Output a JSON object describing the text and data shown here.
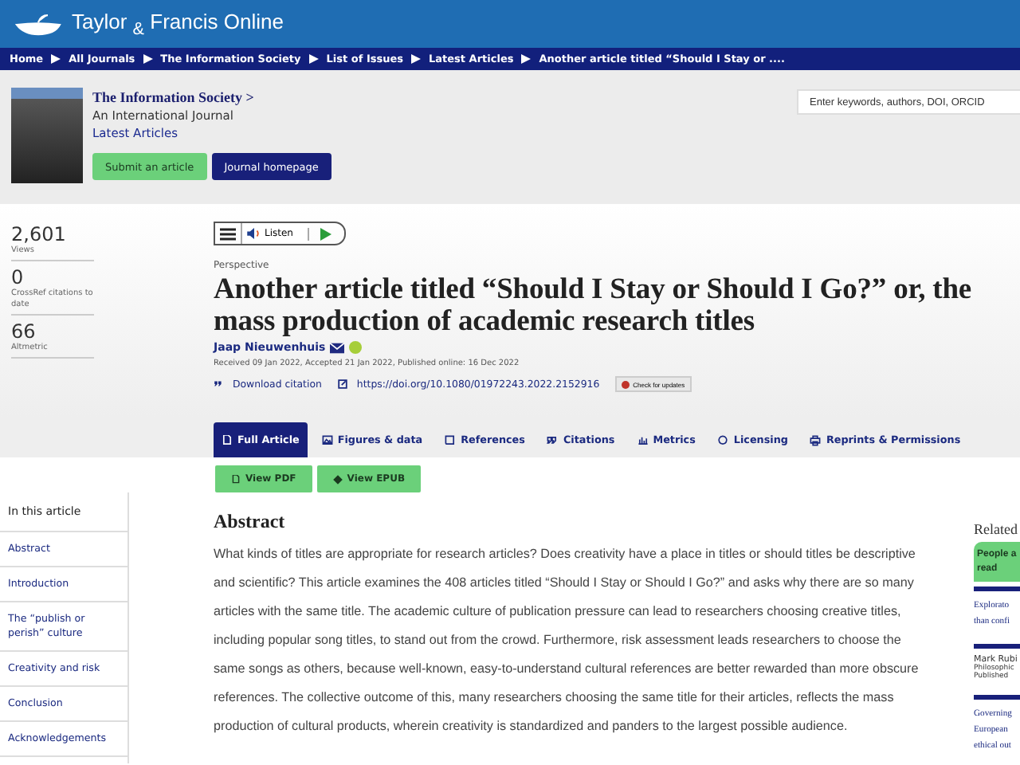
{
  "brand": "Taylor $_{&}$ Francis Online",
  "breadcrumb": [
    "Home",
    "All Journals",
    "The Information Society",
    "List of Issues",
    "Latest Articles",
    "Another article titled “Should I Stay or ...."
  ],
  "journal": {
    "title": "The Information Society >",
    "subtitle": "An International Journal",
    "latest": "Latest Articles",
    "buttons": [
      {
        "label": "Submit an article",
        "kind": "primary"
      },
      {
        "label": "Journal homepage",
        "kind": "secondary"
      }
    ]
  },
  "search": {
    "placeholder": "Enter keywords, authors, DOI, ORCID"
  },
  "metrics": [
    {
      "value": "2,601",
      "label": "Views"
    },
    {
      "value": "0",
      "label": "CrossRef citations to date"
    },
    {
      "value": "66",
      "label": "Altmetric"
    }
  ],
  "listen": {
    "label": "Listen"
  },
  "article": {
    "type": "Perspective",
    "title": "Another article titled “Should I Stay or Should I Go?” or, the mass production of academic research titles",
    "author": "Jaap Nieuwenhuis",
    "dates": "Received 09 Jan 2022, Accepted 21 Jan 2022, Published online: 16 Dec 2022",
    "download": "Download citation",
    "doi": "https://doi.org/10.1080/01972243.2022.2152916",
    "check": "Check for updates"
  },
  "tabs": [
    {
      "label": "Full Article",
      "kind": "doc",
      "selected": true
    },
    {
      "label": "Figures & data",
      "kind": "image",
      "selected": false
    },
    {
      "label": "References",
      "kind": "book",
      "selected": false
    },
    {
      "label": "Citations",
      "kind": "quote",
      "selected": false
    },
    {
      "label": "Metrics",
      "kind": "chart",
      "selected": false
    },
    {
      "label": "Licensing",
      "kind": "circle",
      "selected": false
    },
    {
      "label": "Reprints & Permissions",
      "kind": "print",
      "selected": false
    }
  ],
  "downloads": [
    {
      "label": "View PDF",
      "kind": "pdf"
    },
    {
      "label": "View EPUB",
      "kind": "epub"
    }
  ],
  "toc": {
    "heading": "In this article",
    "items": [
      "Abstract",
      "Introduction",
      "The “publish or perish” culture",
      "Creativity and risk",
      "Conclusion",
      "Acknowledgements"
    ]
  },
  "abstract": {
    "heading": "Abstract",
    "text": "What kinds of titles are appropriate for research articles? Does creativity have a place in titles or should titles be descriptive and scientific? This article examines the 408 articles titled “Should I Stay or Should I Go?” and asks why there are so many articles with the same title. The academic culture of publication pressure can lead to researchers choosing creative titles, including popular song titles, to stand out from the crowd. Furthermore, risk assessment leads researchers to choose the same songs as others, because well-known, easy-to-understand cultural references are better rewarded than more obscure references. The collective outcome of this, many researchers choosing the same title for their articles, reflects the mass production of cultural products, wherein creativity is standardized and panders to the largest possible audience."
  },
  "related": {
    "heading": "Related",
    "tab": "People a read",
    "items": [
      {
        "title": "Explorato than confi"
      },
      {
        "author": "Mark Rubi",
        "journal": "Philosophic",
        "published": "Published"
      },
      {
        "title": "Governing European ethical out"
      }
    ]
  }
}
